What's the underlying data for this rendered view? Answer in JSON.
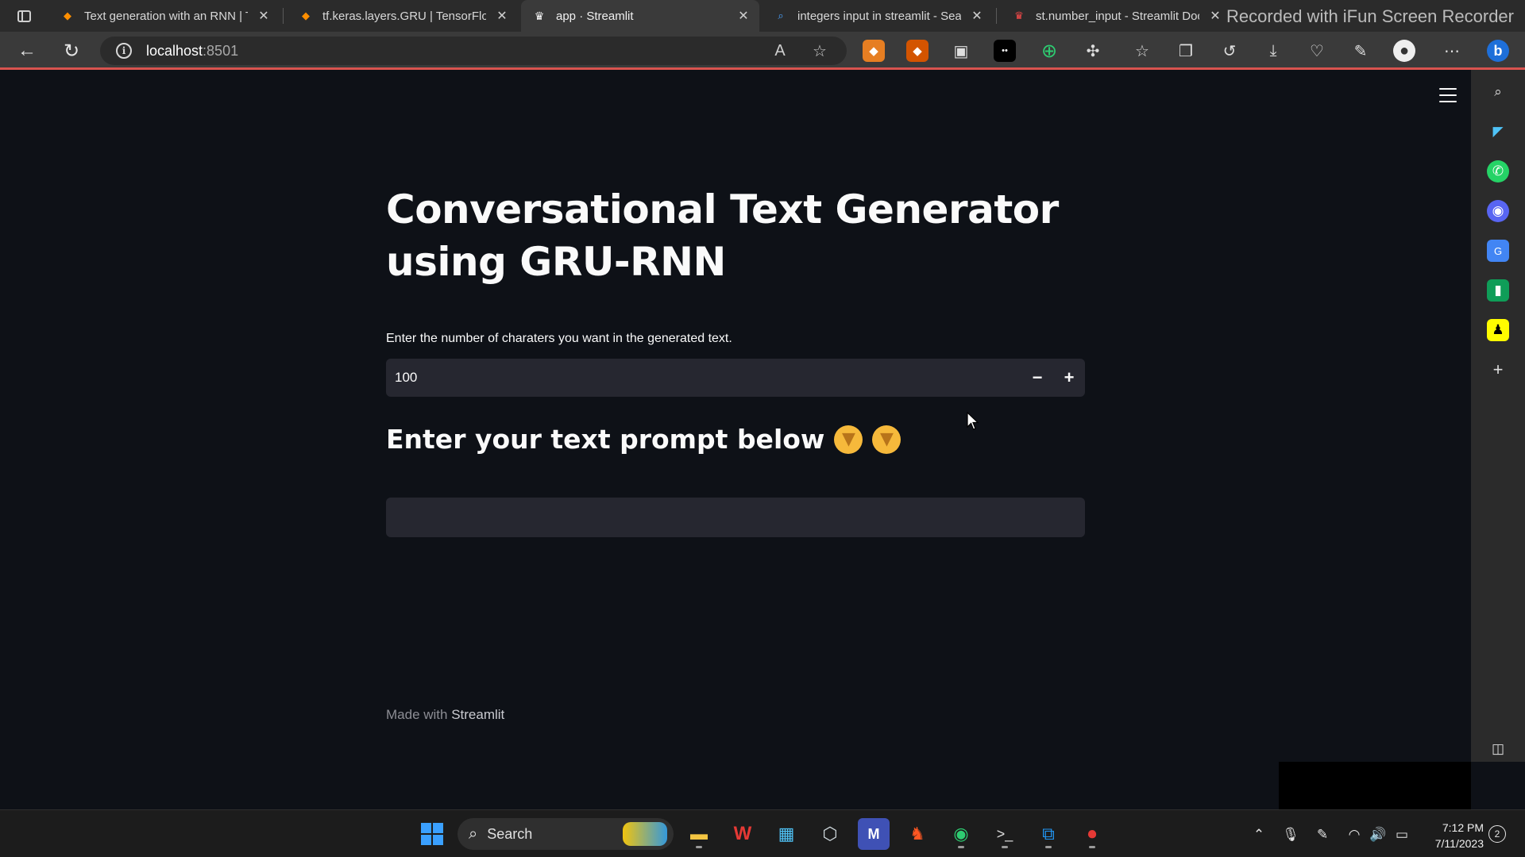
{
  "browser": {
    "tabs": [
      {
        "title": "Text generation with an RNN  |  T",
        "active": false,
        "favicon": "tensorflow-icon"
      },
      {
        "title": "tf.keras.layers.GRU  |  TensorFlow",
        "active": false,
        "favicon": "tensorflow-icon"
      },
      {
        "title": "app · Streamlit",
        "active": true,
        "favicon": "streamlit-icon"
      },
      {
        "title": "integers input in streamlit - Sear",
        "active": false,
        "favicon": "bing-search-icon"
      },
      {
        "title": "st.number_input - Streamlit Docs",
        "active": false,
        "favicon": "streamlit-icon"
      }
    ],
    "recorder_watermark": "Recorded with iFun Screen Recorder",
    "address": {
      "host": "localhost",
      "port": ":8501"
    },
    "accent_color": "#d9534f"
  },
  "app": {
    "title": "Conversational Text Generator using GRU-RNN",
    "number_input": {
      "label": "Enter the number of charaters you want in the generated text.",
      "value": "100",
      "decrement": "−",
      "increment": "+"
    },
    "prompt_heading": "Enter your text prompt below",
    "prompt_emoji": "👇",
    "prompt_input_value": "",
    "footer": {
      "prefix": "Made with ",
      "brand": "Streamlit"
    },
    "background_color": "#0e1117",
    "input_background_color": "#262730"
  },
  "taskbar": {
    "search_label": "Search",
    "time": "7:12 PM",
    "date": "7/11/2023",
    "notification_count": "2"
  }
}
